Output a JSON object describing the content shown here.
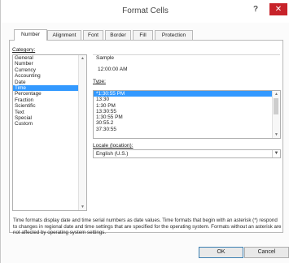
{
  "window": {
    "title": "Format Cells",
    "help_label": "?",
    "close_label": "✕"
  },
  "tabs": [
    {
      "label": "Number"
    },
    {
      "label": "Alignment"
    },
    {
      "label": "Font"
    },
    {
      "label": "Border"
    },
    {
      "label": "Fill"
    },
    {
      "label": "Protection"
    }
  ],
  "category": {
    "label": "Category:",
    "items": [
      "General",
      "Number",
      "Currency",
      "Accounting",
      "Date",
      "Time",
      "Percentage",
      "Fraction",
      "Scientific",
      "Text",
      "Special",
      "Custom"
    ],
    "selected": "Time"
  },
  "sample": {
    "label": "Sample",
    "value": "12:00:00 AM"
  },
  "type": {
    "label": "Type:",
    "input_value": "",
    "items": [
      "*1:30:55 PM",
      "13:30",
      "1:30 PM",
      "13:30:55",
      "1:30:55 PM",
      "30:55.2",
      "37:30:55"
    ],
    "selected": "*1:30:55 PM"
  },
  "locale": {
    "label": "Locale (location):",
    "value": "English (U.S.)"
  },
  "description": "Time formats display date and time serial numbers as date values.  Time formats that begin with an asterisk (*) respond to changes in regional date and time settings that are specified for the operating system. Formats without an asterisk are not affected by operating system settings.",
  "buttons": {
    "ok": "OK",
    "cancel": "Cancel"
  },
  "icons": {
    "close": "close-icon",
    "help": "help-icon",
    "dropdown": "chevron-down-icon"
  },
  "colors": {
    "selection": "#3399ff",
    "close": "#c7232a"
  }
}
